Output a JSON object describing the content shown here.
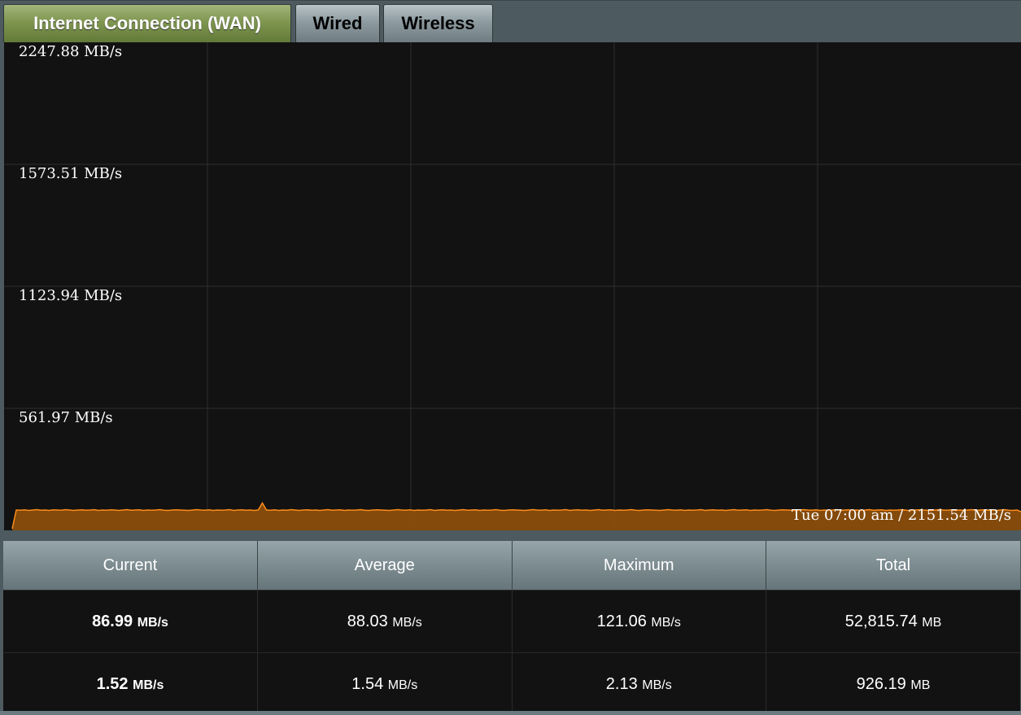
{
  "tabs": [
    {
      "label": "Internet Connection (WAN)",
      "active": true
    },
    {
      "label": "Wired",
      "active": false
    },
    {
      "label": "Wireless",
      "active": false
    }
  ],
  "chart_data": {
    "type": "area",
    "y_tick_labels": [
      "2247.88 MB/s",
      "1573.51 MB/s",
      "1123.94 MB/s",
      "561.97 MB/s"
    ],
    "ylim": [
      0,
      2247.88
    ],
    "grid": true,
    "series": [
      {
        "color": "#ff8c1a",
        "values": [
          0,
          88,
          87,
          89,
          86,
          88,
          90,
          87,
          88,
          86,
          89,
          88,
          87,
          90,
          88,
          86,
          88,
          89,
          87,
          88,
          90,
          86,
          88,
          87,
          89,
          88,
          86,
          88,
          90,
          87,
          88,
          89,
          86,
          88,
          87,
          88,
          90,
          87,
          86,
          88,
          89,
          88,
          87,
          86,
          88,
          90,
          88,
          87,
          89,
          86,
          88,
          87,
          88,
          90,
          86,
          88,
          89,
          87,
          88,
          86,
          88,
          121,
          88,
          87,
          89,
          86,
          88,
          87,
          90,
          88,
          86,
          88,
          89,
          87,
          88,
          86,
          88,
          90,
          87,
          88,
          89,
          86,
          88,
          87,
          88,
          90,
          87,
          86,
          88,
          89,
          88,
          87,
          86,
          88,
          90,
          88,
          87,
          89,
          86,
          88,
          87,
          88,
          90,
          86,
          88,
          89,
          87,
          88,
          86,
          88,
          90,
          87,
          88,
          89,
          86,
          88,
          87,
          88,
          90,
          87,
          86,
          88,
          89,
          88,
          87,
          86,
          88,
          90,
          88,
          87,
          89,
          86,
          88,
          87,
          88,
          90,
          86,
          88,
          89,
          87,
          88,
          86,
          88,
          90,
          87,
          88,
          89,
          86,
          88,
          87,
          88,
          90,
          87,
          86,
          88,
          89,
          88,
          87,
          86,
          88,
          90,
          88,
          87,
          89,
          86,
          88,
          87,
          88,
          90,
          86,
          88,
          89,
          87,
          88,
          86,
          88,
          90,
          87,
          88,
          89,
          86,
          88,
          87,
          88,
          90,
          87,
          86,
          88,
          89,
          88,
          87,
          86,
          88,
          90,
          88,
          87,
          89,
          86,
          88,
          87,
          88,
          90,
          86,
          88,
          89,
          87,
          88,
          86,
          88,
          90,
          87,
          88,
          89,
          86,
          88,
          87,
          88,
          90,
          87,
          86,
          88,
          89,
          88,
          87,
          86,
          88,
          90,
          88,
          87,
          89,
          86,
          88,
          87,
          88,
          90,
          86,
          88,
          89,
          87,
          88,
          86,
          88,
          90,
          87,
          86,
          88,
          80
        ]
      }
    ],
    "tooltip": "Tue 07:00 am / 2151.54 MB/s"
  },
  "stats": {
    "headers": [
      "Current",
      "Average",
      "Maximum",
      "Total"
    ],
    "rows": [
      {
        "current": "86.99",
        "current_unit": "MB/s",
        "average": "88.03",
        "average_unit": "MB/s",
        "maximum": "121.06",
        "maximum_unit": "MB/s",
        "total": "52,815.74",
        "total_unit": "MB"
      },
      {
        "current": "1.52",
        "current_unit": "MB/s",
        "average": "1.54",
        "average_unit": "MB/s",
        "maximum": "2.13",
        "maximum_unit": "MB/s",
        "total": "926.19",
        "total_unit": "MB"
      }
    ]
  },
  "colors": {
    "rx": "#ff8c1a",
    "tx": "#3fbfff",
    "active_tab": "#7f9650"
  }
}
